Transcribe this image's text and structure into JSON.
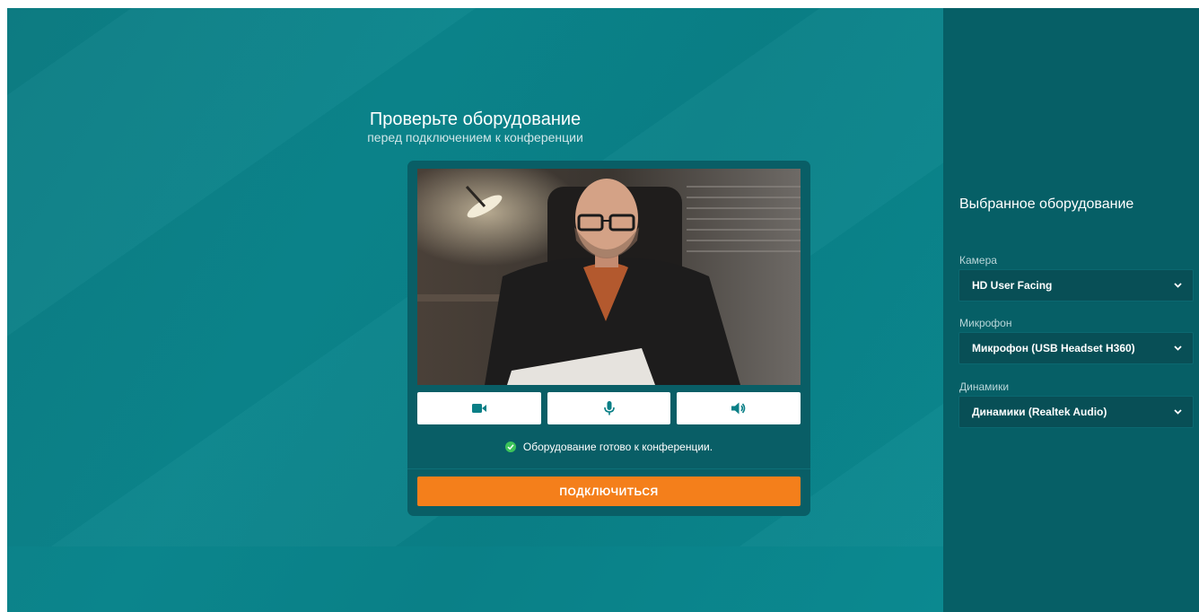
{
  "header": {
    "title": "Проверьте оборудование",
    "subtitle": "перед подключением к конференции"
  },
  "controls": {
    "camera_icon": "video-camera-icon",
    "mic_icon": "microphone-icon",
    "speaker_icon": "speaker-icon"
  },
  "status": {
    "text": "Оборудование готово к конференции.",
    "color": "#3cc35a"
  },
  "connect_button": {
    "label": "ПОДКЛЮЧИТЬСЯ",
    "color": "#f47f1b"
  },
  "sidebar": {
    "title": "Выбранное оборудование",
    "camera": {
      "label": "Камера",
      "value": "HD User Facing"
    },
    "microphone": {
      "label": "Микрофон",
      "value": "Микрофон (USB Headset H360)"
    },
    "speakers": {
      "label": "Динамики",
      "value": "Динамики (Realtek Audio)"
    }
  },
  "colors": {
    "accent": "#0a8087",
    "sidebar_bg": "#065f66",
    "card_bg": "#095e66",
    "icon": "#0a7f86"
  }
}
